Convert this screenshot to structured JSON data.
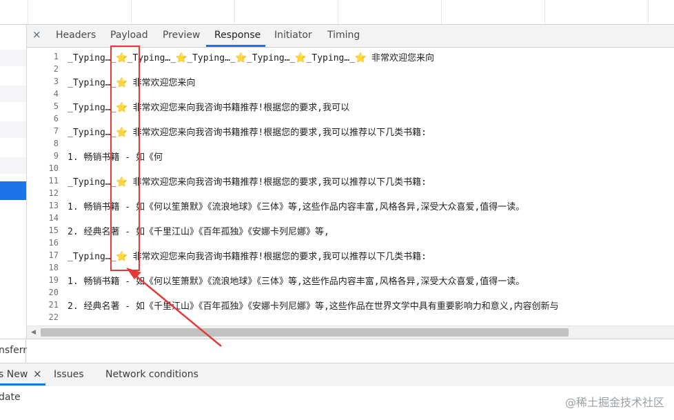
{
  "devtools": {
    "close_icon": "×",
    "tabs": [
      "Headers",
      "Payload",
      "Preview",
      "Response",
      "Initiator",
      "Timing"
    ],
    "active_tab": "Response"
  },
  "response_lines": [
    {
      "n": "1",
      "text_a": "_Typing…_",
      "star": "⭐",
      "text_b": "_Typing…_",
      "star2": "⭐",
      "text_c": "_Typing…_",
      "star3": "⭐",
      "text_d": "_Typing…_",
      "star4": "⭐",
      "text_e": "_Typing…_",
      "star5": "⭐",
      "text_f": " 非常欢迎您来向"
    },
    {
      "n": "2"
    },
    {
      "n": "3",
      "text_a": "_Typing…_",
      "star": "⭐",
      "text_b": " 非常欢迎您来向"
    },
    {
      "n": "4"
    },
    {
      "n": "5",
      "text_a": "_Typing…_",
      "star": "⭐",
      "text_b": " 非常欢迎您来向我咨询书籍推荐!根据您的要求,我可以"
    },
    {
      "n": "6"
    },
    {
      "n": "7",
      "text_a": "_Typing…_",
      "star": "⭐",
      "text_b": " 非常欢迎您来向我咨询书籍推荐!根据您的要求,我可以推荐以下几类书籍:"
    },
    {
      "n": "8"
    },
    {
      "n": "9",
      "text_a": "1. 畅销书籍 - 如《何"
    },
    {
      "n": "10"
    },
    {
      "n": "11",
      "text_a": "_Typing…_",
      "star": "⭐",
      "text_b": " 非常欢迎您来向我咨询书籍推荐!根据您的要求,我可以推荐以下几类书籍:"
    },
    {
      "n": "12"
    },
    {
      "n": "13",
      "text_a": "1. 畅销书籍 - 如《何以笙箫默》《流浪地球》《三体》等,这些作品内容丰富,风格各异,深受大众喜爱,值得一读。"
    },
    {
      "n": "14"
    },
    {
      "n": "15",
      "text_a": "2. 经典名著 - 如《千里江山》《百年孤独》《安娜卡列尼娜》等,"
    },
    {
      "n": "16"
    },
    {
      "n": "17",
      "text_a": "_Typing…_",
      "star": "⭐",
      "text_b": " 非常欢迎您来向我咨询书籍推荐!根据您的要求,我可以推荐以下几类书籍:"
    },
    {
      "n": "18"
    },
    {
      "n": "19",
      "text_a": "1. 畅销书籍 - 如《何以笙箫默》《流浪地球》《三体》等,这些作品内容丰富,风格各异,深受大众喜爱,值得一读。"
    },
    {
      "n": "20"
    },
    {
      "n": "21",
      "text_a": "2. 经典名著 - 如《千里江山》《百年孤独》《安娜卡列尼娜》等,这些作品在世界文学中具有重要影响力和意义,内容创新与"
    },
    {
      "n": "22"
    }
  ],
  "status_bar": {
    "text": "nsferr"
  },
  "drawer": {
    "tabs": [
      "s New",
      "Issues",
      "Network conditions"
    ],
    "tab_close": "×",
    "body_text": "date"
  },
  "watermark": "@稀土掘金技术社区",
  "colors": {
    "accent": "#1a73e8",
    "annotation": "#e53935",
    "star": "#f2b01e"
  }
}
